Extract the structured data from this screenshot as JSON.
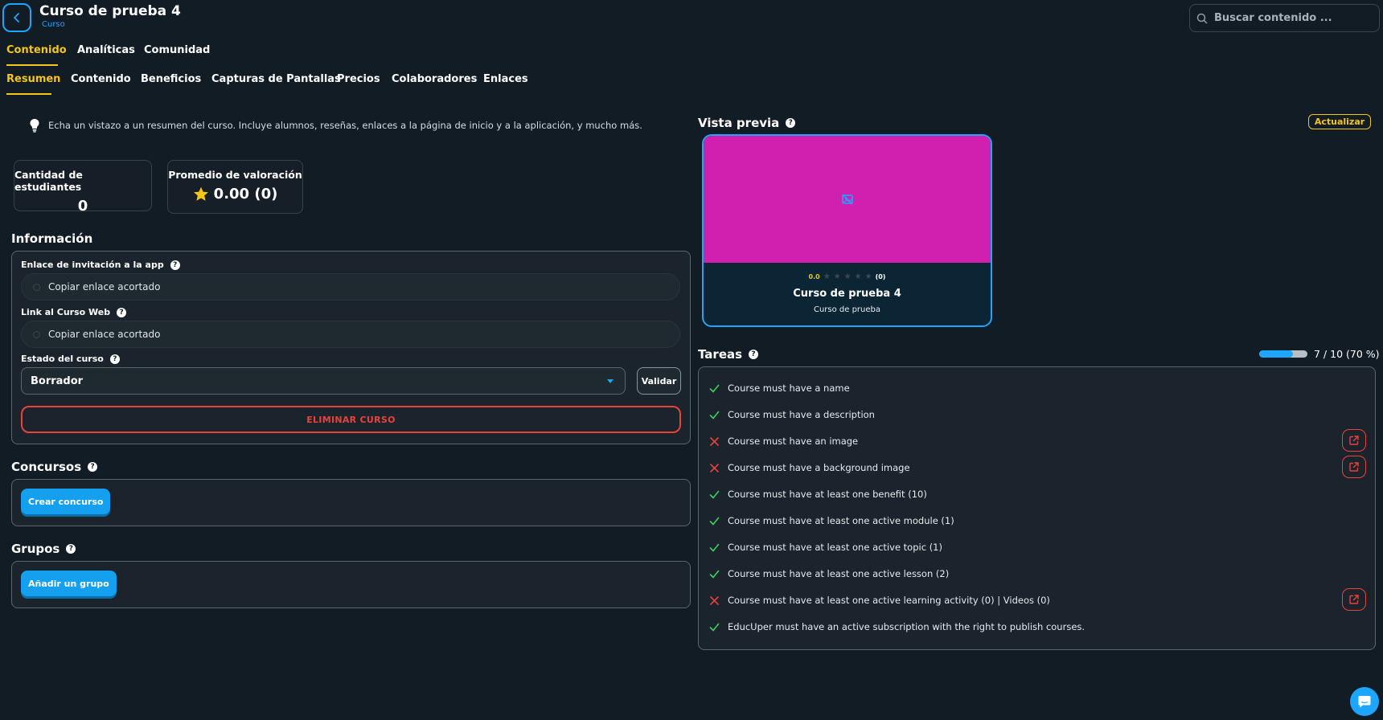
{
  "header": {
    "title": "Curso de prueba 4",
    "subtitle": "Curso",
    "search_placeholder": "Buscar contenido ..."
  },
  "main_tabs": [
    {
      "label": "Contenido",
      "active": true
    },
    {
      "label": "Analíticas",
      "active": false
    },
    {
      "label": "Comunidad",
      "active": false
    }
  ],
  "sub_tabs": [
    {
      "label": "Resumen",
      "active": true
    },
    {
      "label": "Contenido",
      "active": false
    },
    {
      "label": "Beneficios",
      "active": false
    },
    {
      "label": "Capturas de Pantallas",
      "active": false
    },
    {
      "label": "Precios",
      "active": false
    },
    {
      "label": "Colaboradores",
      "active": false
    },
    {
      "label": "Enlaces",
      "active": false
    }
  ],
  "hint": "Echa un vistazo a un resumen del curso. Incluye alumnos, reseñas, enlaces a la página de inicio y a la aplicación, y mucho más.",
  "stats": {
    "students_label": "Cantidad de estudiantes",
    "students_value": "0",
    "rating_label": "Promedio de valoración",
    "rating_value": "0.00 (0)"
  },
  "info": {
    "title": "Información",
    "app_link_label": "Enlace de invitación a la app",
    "app_link_value": "Copiar enlace acortado",
    "web_link_label": "Link al Curso Web",
    "web_link_value": "Copiar enlace acortado",
    "status_label": "Estado del curso",
    "status_value": "Borrador",
    "validate_label": "Validar",
    "delete_label": "ELIMINAR CURSO"
  },
  "contests": {
    "title": "Concursos",
    "button": "Crear concurso"
  },
  "groups": {
    "title": "Grupos",
    "button": "Añadir un grupo"
  },
  "preview": {
    "title": "Vista previa",
    "update_label": "Actualizar",
    "rating_value": "0.0",
    "rating_count": "(0)",
    "card_title": "Curso de prueba 4",
    "card_subtitle": "Curso de prueba",
    "image_color": "#d11fb0"
  },
  "tasks": {
    "title": "Tareas",
    "progress_text": "7 / 10 (70 %)",
    "progress_fraction": 0.7,
    "items": [
      {
        "label": "Course must have a name",
        "done": true
      },
      {
        "label": "Course must have a description",
        "done": true
      },
      {
        "label": "Course must have an image",
        "done": false
      },
      {
        "label": "Course must have a background image",
        "done": false
      },
      {
        "label": "Course must have at least one benefit (10)",
        "done": true
      },
      {
        "label": "Course must have at least one active module (1)",
        "done": true
      },
      {
        "label": "Course must have at least one active topic (1)",
        "done": true
      },
      {
        "label": "Course must have at least one active lesson (2)",
        "done": true
      },
      {
        "label": "Course must have at least one active learning activity (0) | Videos (0)",
        "done": false
      },
      {
        "label": "EducUper must have an active subscription with the right to publish courses.",
        "done": true
      }
    ]
  },
  "colors": {
    "accent": "#f5c518",
    "primary": "#1ea5ff",
    "danger": "#e8433a",
    "success": "#3ccf5c",
    "background": "#121c24"
  }
}
